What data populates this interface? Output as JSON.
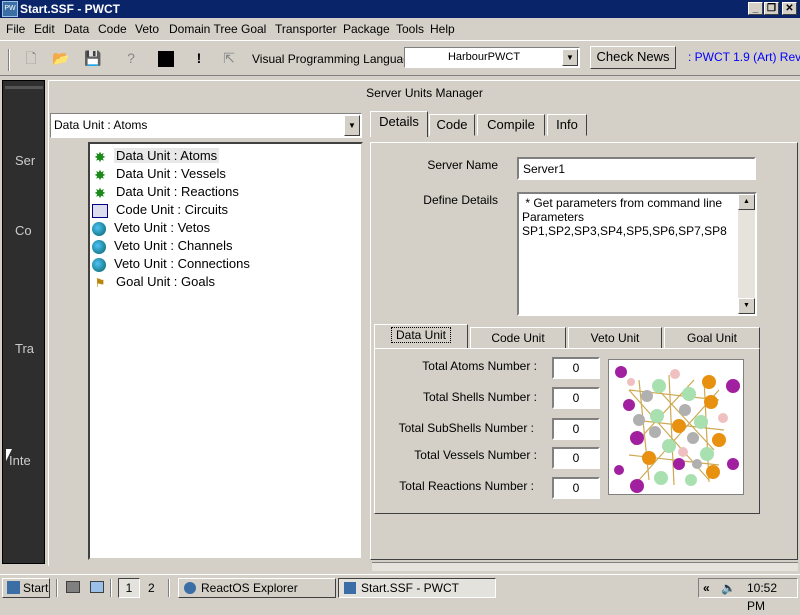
{
  "window": {
    "title": "Start.SSF - PWCT",
    "minimize": "_",
    "maximize": "❐",
    "close": "✕"
  },
  "menu": [
    "File",
    "Edit",
    "Data",
    "Code",
    "Veto",
    "Domain Tree",
    "Goal",
    "Transporter",
    "Package",
    "Tools",
    "Help"
  ],
  "toolbar": {
    "vpl_label": "Visual Programming Language",
    "vpl_value": "HarbourPWCT",
    "check_news": "Check News",
    "version": ": PWCT 1.9 (Art) Rev"
  },
  "sidebar": {
    "labels": [
      "Ser",
      "Co",
      "Tra",
      "Inte"
    ]
  },
  "panel": {
    "title": "Server Units Manager"
  },
  "unit_combo": {
    "value": "Data Unit : Atoms"
  },
  "tree": {
    "items": [
      {
        "label": "Data Unit : Atoms",
        "icon": "atom-icon",
        "selected": true
      },
      {
        "label": "Data Unit : Vessels",
        "icon": "atom-icon"
      },
      {
        "label": "Data Unit : Reactions",
        "icon": "atom-icon"
      },
      {
        "label": "Code Unit : Circuits",
        "icon": "circuit-icon"
      },
      {
        "label": "Veto Unit : Vetos",
        "icon": "globe-icon"
      },
      {
        "label": "Veto Unit : Channels",
        "icon": "globe-icon"
      },
      {
        "label": "Veto Unit : Connections",
        "icon": "globe-icon"
      },
      {
        "label": "Goal Unit : Goals",
        "icon": "goal-icon"
      }
    ]
  },
  "tabs": [
    "Details",
    "Code",
    "Compile",
    "Info"
  ],
  "details": {
    "server_name_label": "Server Name",
    "server_name": "Server1",
    "define_details_label": "Define Details",
    "define_details_text": " * Get parameters from command line\nParameters\nSP1,SP2,SP3,SP4,SP5,SP6,SP7,SP8"
  },
  "subtabs": [
    "Data Unit",
    "Code Unit",
    "Veto Unit",
    "Goal Unit"
  ],
  "stats": [
    {
      "label": "Total Atoms Number :",
      "value": "0"
    },
    {
      "label": "Total Shells Number :",
      "value": "0"
    },
    {
      "label": "Total SubShells Number :",
      "value": "0"
    },
    {
      "label": "Total Vessels Number :",
      "value": "0"
    },
    {
      "label": "Total Reactions Number :",
      "value": "0"
    }
  ],
  "taskbar": {
    "start": "Start",
    "desk1": "1",
    "desk2": "2",
    "apps": [
      "ReactOS Explorer",
      "Start.SSF - PWCT"
    ],
    "tray_arrows": "«",
    "time": "10:52 PM"
  },
  "colors": {
    "titlebar": "#0a246a",
    "face": "#d4d0c8",
    "sidebar": "#2e2e2e",
    "link": "#0000ff"
  }
}
